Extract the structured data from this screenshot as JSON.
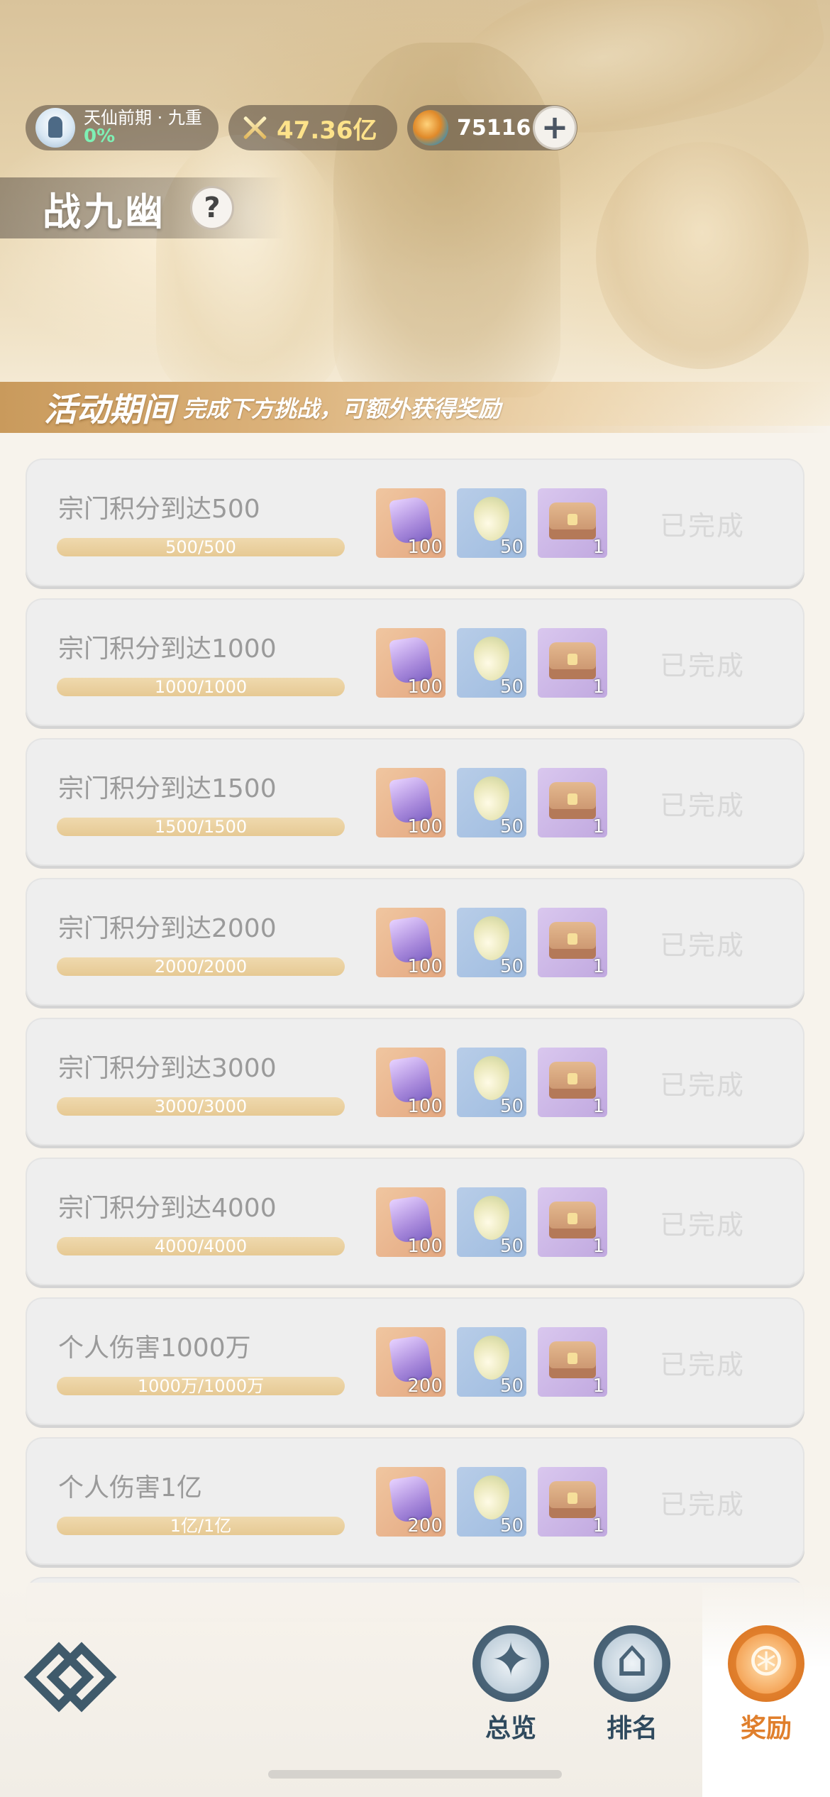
{
  "header": {
    "rank": {
      "title": "天仙前期 · 九重",
      "percent": "0%"
    },
    "power": "47.36亿",
    "currency": "75116",
    "page_title": "战九幽",
    "help_label": "?"
  },
  "banner": {
    "strong": "活动期间",
    "sub": "完成下方挑战，可额外获得奖励"
  },
  "tasks": [
    {
      "title": "宗门积分到达500",
      "progress": "500/500",
      "rewards": [
        "100",
        "50",
        "1"
      ],
      "status": "已完成"
    },
    {
      "title": "宗门积分到达1000",
      "progress": "1000/1000",
      "rewards": [
        "100",
        "50",
        "1"
      ],
      "status": "已完成"
    },
    {
      "title": "宗门积分到达1500",
      "progress": "1500/1500",
      "rewards": [
        "100",
        "50",
        "1"
      ],
      "status": "已完成"
    },
    {
      "title": "宗门积分到达2000",
      "progress": "2000/2000",
      "rewards": [
        "100",
        "50",
        "1"
      ],
      "status": "已完成"
    },
    {
      "title": "宗门积分到达3000",
      "progress": "3000/3000",
      "rewards": [
        "100",
        "50",
        "1"
      ],
      "status": "已完成"
    },
    {
      "title": "宗门积分到达4000",
      "progress": "4000/4000",
      "rewards": [
        "100",
        "50",
        "1"
      ],
      "status": "已完成"
    },
    {
      "title": "个人伤害1000万",
      "progress": "1000万/1000万",
      "rewards": [
        "200",
        "50",
        "1"
      ],
      "status": "已完成"
    },
    {
      "title": "个人伤害1亿",
      "progress": "1亿/1亿",
      "rewards": [
        "200",
        "50",
        "1"
      ],
      "status": "已完成"
    }
  ],
  "nav": {
    "overview": "总览",
    "rank": "排名",
    "reward": "奖励"
  },
  "icons": {
    "home": "home-diamond-icon",
    "overview": "compass-icon",
    "rank": "temple-icon",
    "reward": "reward-bag-icon"
  },
  "colors": {
    "accent": "#e07f2c",
    "nav_text": "#2f4a5e",
    "completed_text": "#d8d8d8"
  }
}
